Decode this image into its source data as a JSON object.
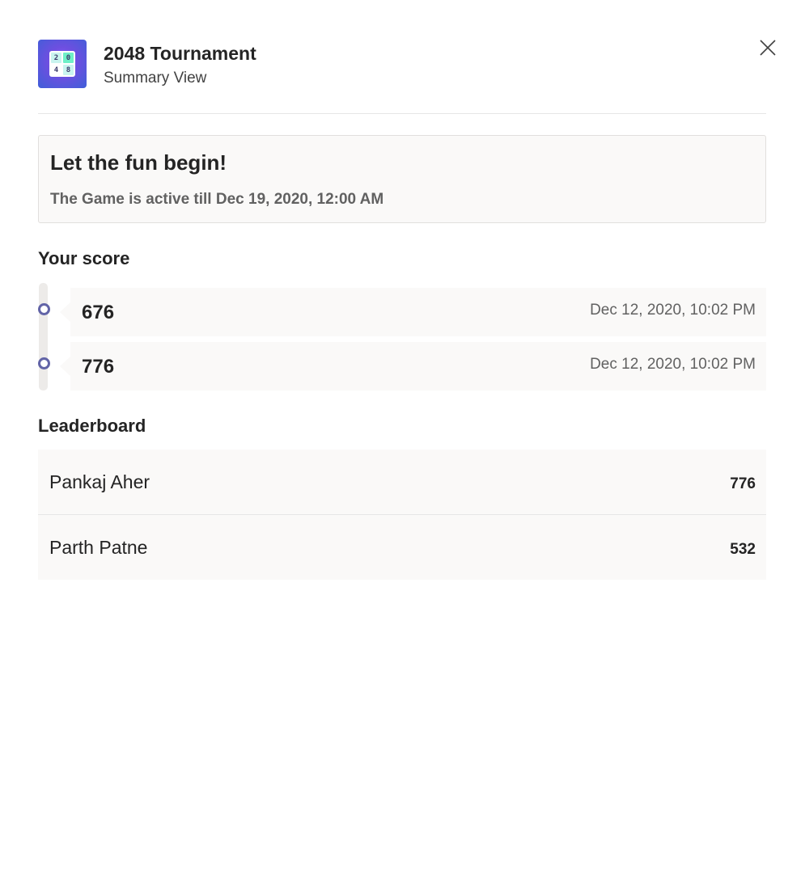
{
  "header": {
    "title": "2048 Tournament",
    "subtitle": "Summary View",
    "icon": "game-2048-icon",
    "icon_tiles": [
      "2",
      "0",
      "4",
      "8"
    ]
  },
  "banner": {
    "title": "Let the fun begin!",
    "subtitle": "The Game is active till Dec 19, 2020, 12:00 AM"
  },
  "your_score": {
    "title": "Your score",
    "entries": [
      {
        "score": "676",
        "date": "Dec 12, 2020, 10:02 PM"
      },
      {
        "score": "776",
        "date": "Dec 12, 2020, 10:02 PM"
      }
    ]
  },
  "leaderboard": {
    "title": "Leaderboard",
    "rows": [
      {
        "name": "Pankaj Aher",
        "score": "776"
      },
      {
        "name": "Parth Patne",
        "score": "532"
      }
    ]
  },
  "colors": {
    "accent": "#6264a7",
    "card_bg": "#faf9f8"
  }
}
